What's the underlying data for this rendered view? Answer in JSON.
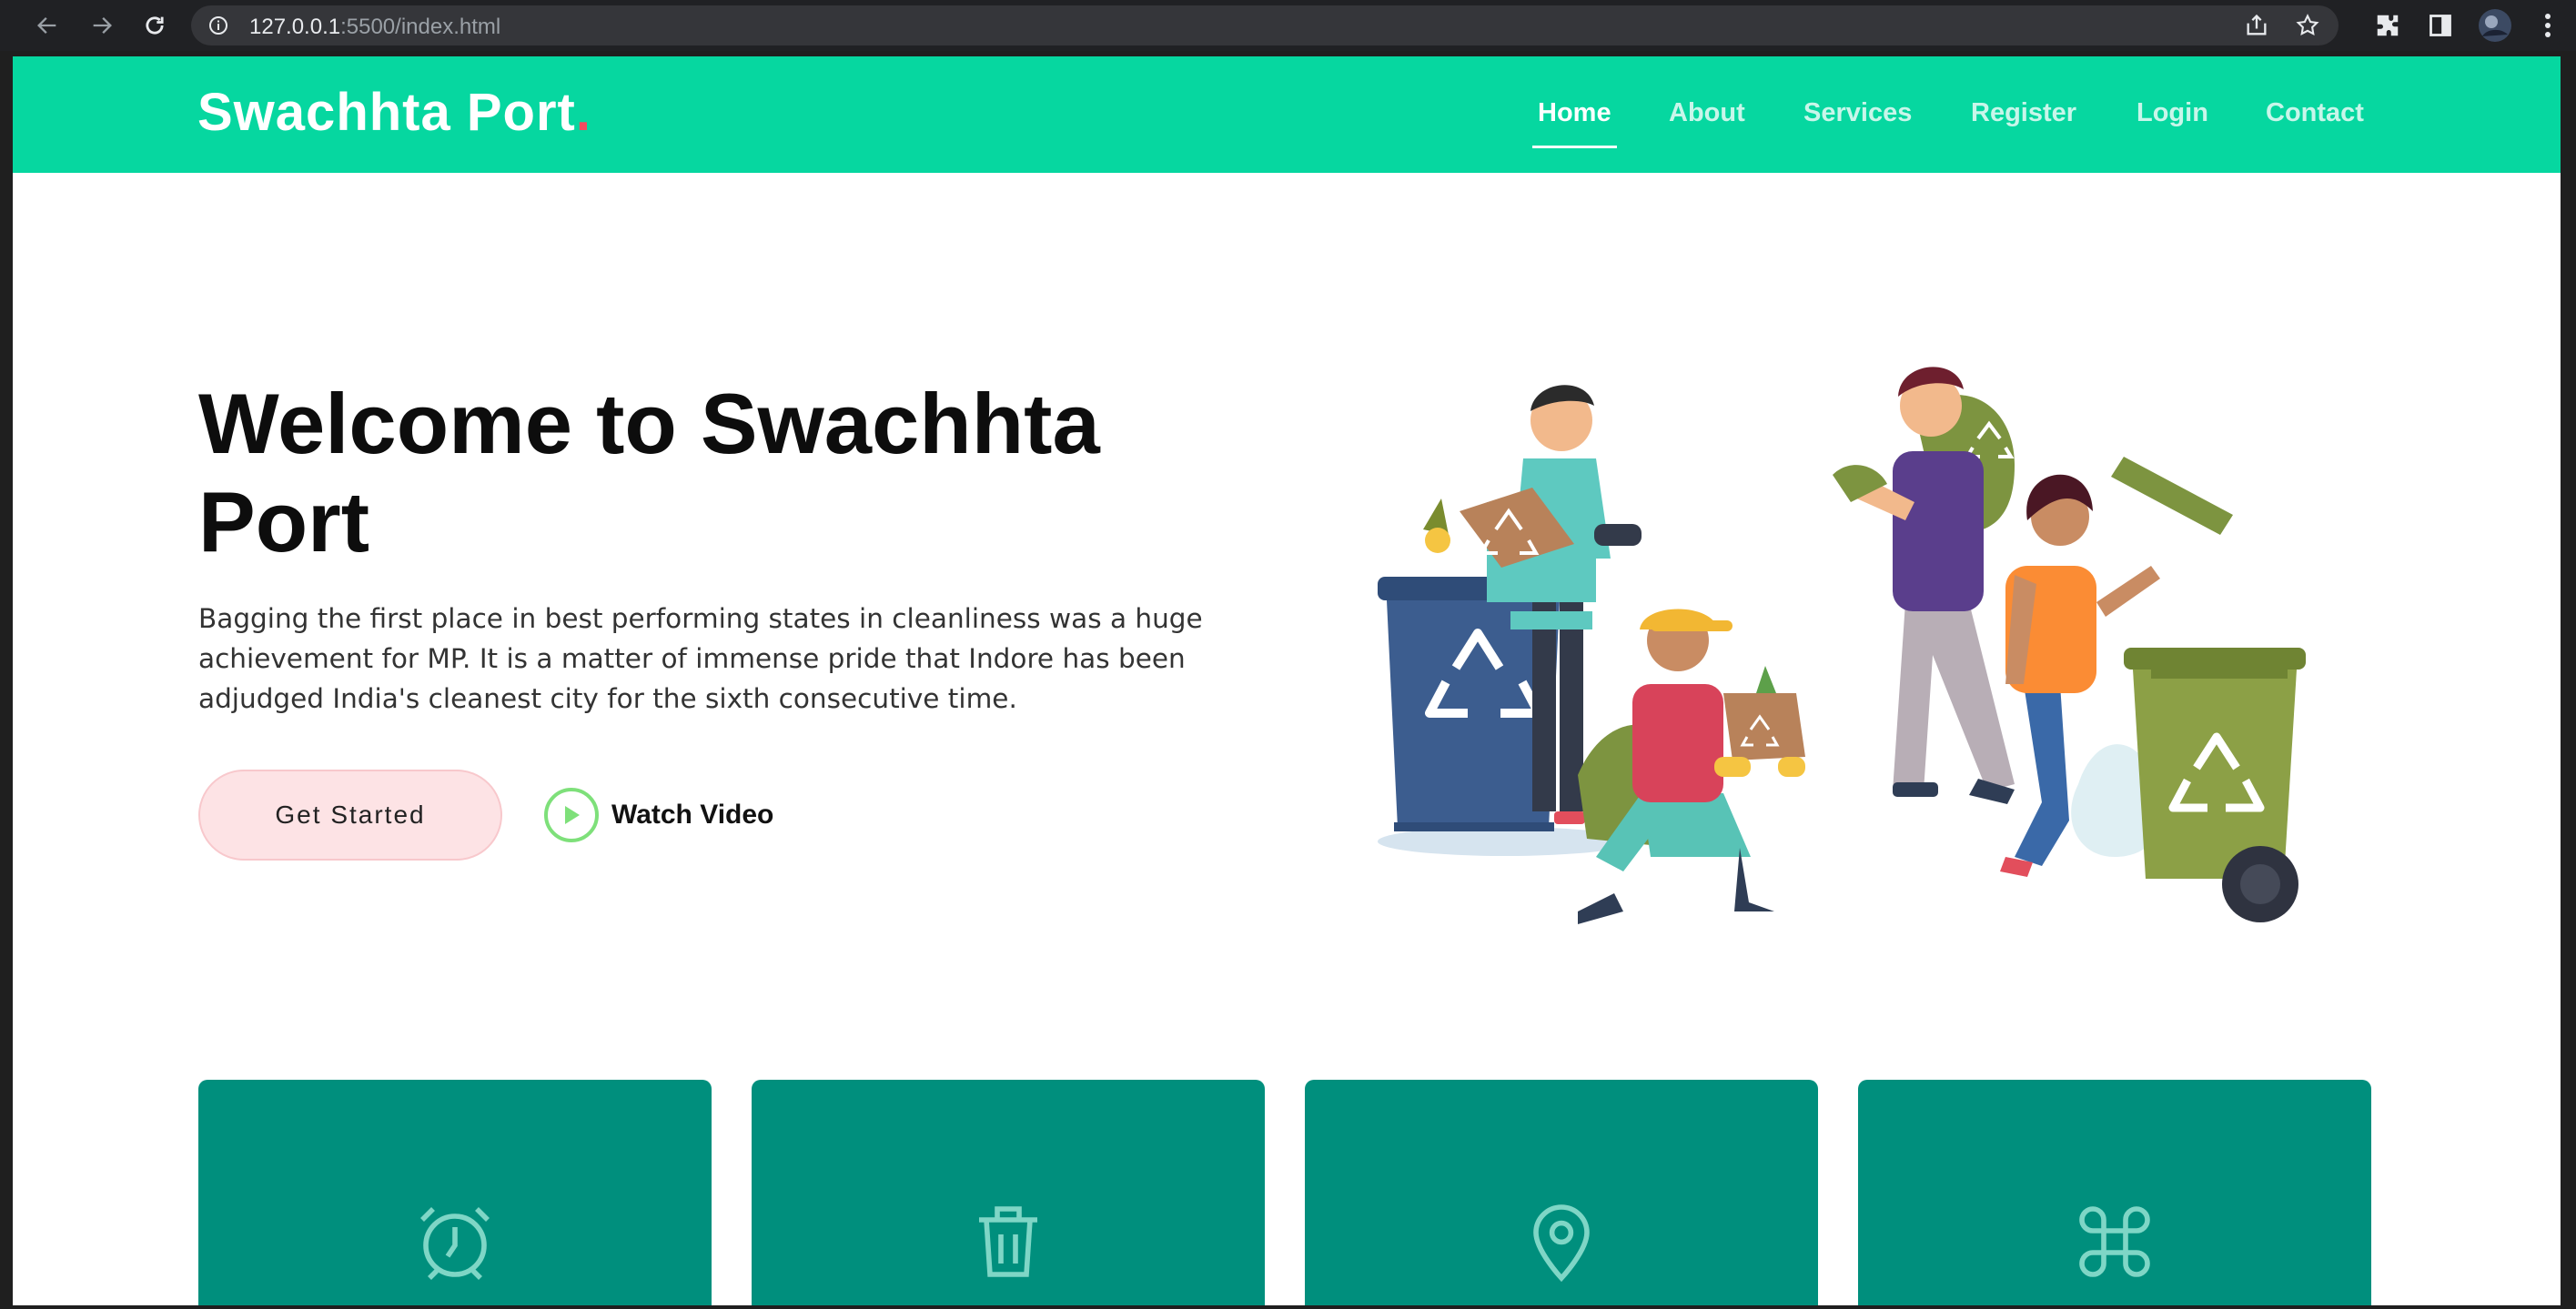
{
  "browser": {
    "url_host": "127.0.0.1",
    "url_rest": ":5500/index.html"
  },
  "header": {
    "logo": "Swachhta Port",
    "logo_dot": ".",
    "nav": [
      "Home",
      "About",
      "Services",
      "Register",
      "Login",
      "Contact"
    ],
    "active_nav": "Home"
  },
  "hero": {
    "title": "Welcome to Swachhta Port",
    "text": "Bagging the first place in best performing states in cleanliness was a huge achievement for MP. It is a matter of immense pride that Indore has been adjudged India's cleanest city for the sixth consecutive time.",
    "cta_label": "Get Started",
    "video_label": "Watch Video"
  },
  "cards": [
    {
      "icon": "alarm-clock-icon"
    },
    {
      "icon": "trash-bin-icon"
    },
    {
      "icon": "map-pin-icon"
    },
    {
      "icon": "command-icon"
    }
  ],
  "colors": {
    "brand": "#06d7a0",
    "accent": "#f44a5f",
    "card": "#008f7d"
  }
}
